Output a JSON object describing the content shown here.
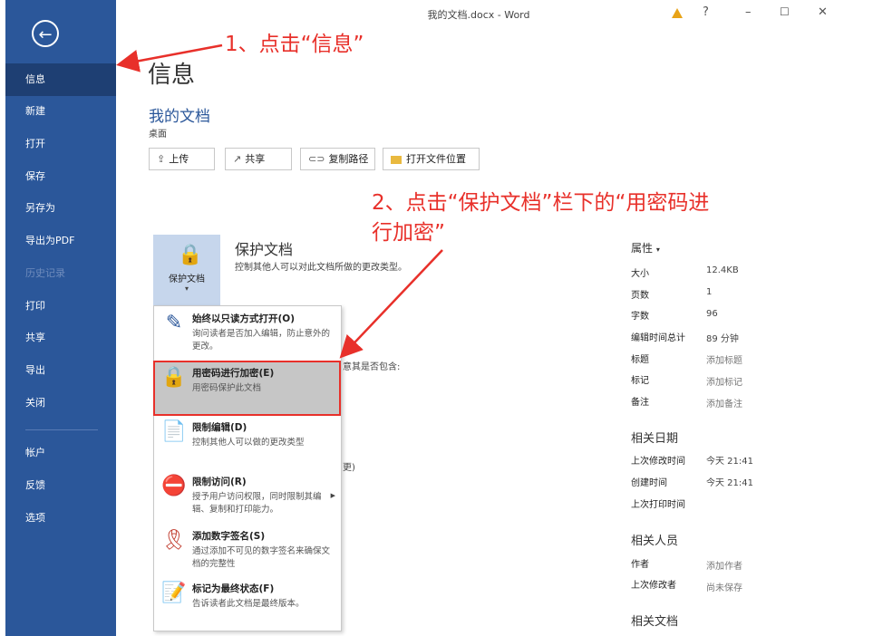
{
  "window": {
    "title": "我的文档.docx - Word",
    "help": "?",
    "minimize": "–",
    "maximize": "☐",
    "close": "✕"
  },
  "sidebar": {
    "back_icon": "←",
    "items": [
      {
        "label": "信息"
      },
      {
        "label": "新建"
      },
      {
        "label": "打开"
      },
      {
        "label": "保存"
      },
      {
        "label": "另存为"
      },
      {
        "label": "导出为PDF"
      },
      {
        "label": "历史记录"
      },
      {
        "label": "打印"
      },
      {
        "label": "共享"
      },
      {
        "label": "导出"
      },
      {
        "label": "关闭"
      },
      {
        "label": "帐户"
      },
      {
        "label": "反馈"
      },
      {
        "label": "选项"
      }
    ]
  },
  "main": {
    "title": "信息",
    "doc_name": "我的文档",
    "doc_location": "桌面",
    "buttons": [
      {
        "icon": "⇪",
        "label": "上传"
      },
      {
        "icon": "↗",
        "label": "共享"
      },
      {
        "icon": "⊂⊃",
        "label": "复制路径"
      },
      {
        "icon": "",
        "label": "打开文件位置"
      }
    ],
    "protect": {
      "tile_label": "保护文档",
      "tile_caret": "▾",
      "heading": "保护文档",
      "desc": "控制其他人可以对此文档所做的更改类型。"
    },
    "partial_text": {
      "a": "意其是否包含:",
      "b": "更)"
    }
  },
  "menu": {
    "items": [
      {
        "title": "始终以只读方式打开(O)",
        "desc": "询问读者是否加入编辑，防止意外的更改。"
      },
      {
        "title": "用密码进行加密(E)",
        "desc": "用密码保护此文档"
      },
      {
        "title": "限制编辑(D)",
        "desc": "控制其他人可以做的更改类型"
      },
      {
        "title": "限制访问(R)",
        "desc": "授予用户访问权限，同时限制其编辑、复制和打印能力。"
      },
      {
        "title": "添加数字签名(S)",
        "desc": "通过添加不可见的数字签名来确保文档的完整性"
      },
      {
        "title": "标记为最终状态(F)",
        "desc": "告诉读者此文档是最终版本。"
      }
    ]
  },
  "annotations": {
    "step1": "1、点击“信息”",
    "step2_line1": "2、点击“保护文档”栏下的“用密码进",
    "step2_line2": "行加密”"
  },
  "properties": {
    "heading": "属性",
    "heading_caret": "▾",
    "rows": [
      {
        "key": "大小",
        "value": "12.4KB"
      },
      {
        "key": "页数",
        "value": "1"
      },
      {
        "key": "字数",
        "value": "96"
      },
      {
        "key": "编辑时间总计",
        "value": "89 分钟"
      },
      {
        "key": "标题",
        "value": "添加标题"
      },
      {
        "key": "标记",
        "value": "添加标记"
      },
      {
        "key": "备注",
        "value": "添加备注"
      }
    ],
    "dates_heading": "相关日期",
    "dates": [
      {
        "key": "上次修改时间",
        "value": "今天 21:41"
      },
      {
        "key": "创建时间",
        "value": "今天 21:41"
      },
      {
        "key": "上次打印时间",
        "value": ""
      }
    ],
    "people_heading": "相关人员",
    "people": [
      {
        "key": "作者",
        "value": "添加作者"
      },
      {
        "key": "上次修改者",
        "value": "尚未保存"
      }
    ],
    "docs_heading": "相关文档"
  },
  "colors": {
    "sidebar": "#2b579a",
    "accent": "#2b579a",
    "annotation": "#e8302a",
    "highlight": "#c6c6c6"
  }
}
